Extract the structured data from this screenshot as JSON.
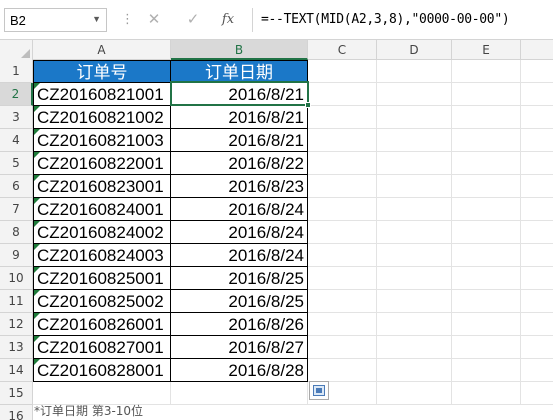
{
  "name_box": {
    "value": "B2"
  },
  "formula_bar": {
    "cancel_icon": "✕",
    "enter_icon": "✓",
    "fx_label": "fx",
    "formula": "=--TEXT(MID(A2,3,8),\"0000-00-00\")"
  },
  "columns": [
    "A",
    "B",
    "C",
    "D",
    "E"
  ],
  "header_row": {
    "row": "1",
    "a": "订单号",
    "b": "订单日期"
  },
  "rows": [
    {
      "row": "2",
      "a": "CZ20160821001",
      "b": "2016/8/21"
    },
    {
      "row": "3",
      "a": "CZ20160821002",
      "b": "2016/8/21"
    },
    {
      "row": "4",
      "a": "CZ20160821003",
      "b": "2016/8/21"
    },
    {
      "row": "5",
      "a": "CZ20160822001",
      "b": "2016/8/22"
    },
    {
      "row": "6",
      "a": "CZ20160823001",
      "b": "2016/8/23"
    },
    {
      "row": "7",
      "a": "CZ20160824001",
      "b": "2016/8/24"
    },
    {
      "row": "8",
      "a": "CZ20160824002",
      "b": "2016/8/24"
    },
    {
      "row": "9",
      "a": "CZ20160824003",
      "b": "2016/8/24"
    },
    {
      "row": "10",
      "a": "CZ20160825001",
      "b": "2016/8/25"
    },
    {
      "row": "11",
      "a": "CZ20160825002",
      "b": "2016/8/25"
    },
    {
      "row": "12",
      "a": "CZ20160826001",
      "b": "2016/8/26"
    },
    {
      "row": "13",
      "a": "CZ20160827001",
      "b": "2016/8/27"
    },
    {
      "row": "14",
      "a": "CZ20160828001",
      "b": "2016/8/28"
    }
  ],
  "empty_rows": [
    "15",
    "16"
  ],
  "caption": "*订单日期  第3-10位",
  "colors": {
    "header_fill": "#1b78c8",
    "selection": "#217346",
    "error_triangle": "#1e7b3a"
  }
}
